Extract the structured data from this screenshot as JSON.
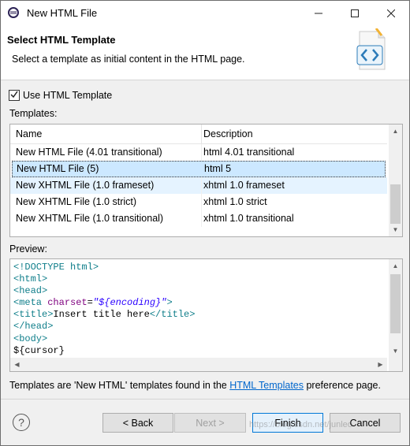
{
  "window": {
    "title": "New HTML File"
  },
  "banner": {
    "title": "Select HTML Template",
    "description": "Select a template as initial content in the HTML page."
  },
  "use_template": {
    "label": "Use HTML Template",
    "checked": true
  },
  "templates": {
    "label": "Templates:",
    "columns": [
      "Name",
      "Description"
    ],
    "rows": [
      {
        "name": "New HTML File (4.01 transitional)",
        "description": "html 4.01 transitional"
      },
      {
        "name": "New HTML File (5)",
        "description": "html 5"
      },
      {
        "name": "New XHTML File (1.0 frameset)",
        "description": "xhtml 1.0 frameset"
      },
      {
        "name": "New XHTML File (1.0 strict)",
        "description": "xhtml 1.0 strict"
      },
      {
        "name": "New XHTML File (1.0 transitional)",
        "description": "xhtml 1.0 transitional"
      }
    ],
    "selected": "New HTML File (5)"
  },
  "preview": {
    "label": "Preview:",
    "code": {
      "doctype_open": "<!DOCTYPE ",
      "doctype_name": "html",
      "doctype_close": ">",
      "html_open": "<html>",
      "head_open": "<head>",
      "meta_tag_open": "<meta ",
      "meta_attr": "charset",
      "meta_eq": "=",
      "meta_val": "\"${encoding}\"",
      "meta_close": ">",
      "title_open": "<title>",
      "title_text": "Insert title here",
      "title_close": "</title>",
      "head_close": "</head>",
      "body_open": "<body>",
      "cursor": "${cursor}"
    }
  },
  "footer_note": {
    "prefix": "Templates are 'New HTML' templates found in the ",
    "link": "HTML Templates",
    "suffix": " preference page."
  },
  "buttons": {
    "back": "< Back",
    "next": "Next >",
    "finish": "Finish",
    "cancel": "Cancel"
  },
  "watermark": "https://blog.csdn.net/junleo",
  "colors": {
    "accent": "#0078d7",
    "selection": "#cce8ff",
    "link": "#0066cc"
  }
}
